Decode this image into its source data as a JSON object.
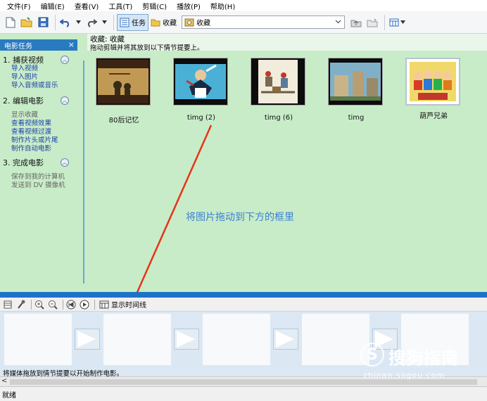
{
  "menu": [
    "文件(F)",
    "编辑(E)",
    "查看(V)",
    "工具(T)",
    "剪辑(C)",
    "播放(P)",
    "帮助(H)"
  ],
  "toolbar": {
    "tasks_label": "任务",
    "collections_label": "收藏",
    "combo_value": "收藏"
  },
  "taskpane": {
    "header": "电影任务",
    "close": "×",
    "sections": [
      {
        "title": "1. 捕获视频",
        "items": [
          "导入视频",
          "导入图片",
          "导入音频或音乐"
        ]
      },
      {
        "title": "2. 编辑电影",
        "items": [
          "显示收藏",
          "查看视频效果",
          "查看视频过渡",
          "制作片头或片尾",
          "制作自动电影"
        ]
      },
      {
        "title": "3. 完成电影",
        "items": [
          "保存到我的计算机",
          "发送到 DV 摄像机"
        ]
      }
    ]
  },
  "collection": {
    "title": "收藏: 收藏",
    "description": "拖动剪辑并将其放到以下情节提要上。",
    "clips": [
      {
        "name": "80后记忆"
      },
      {
        "name": "timg (2)"
      },
      {
        "name": "timg (6)"
      },
      {
        "name": "timg"
      },
      {
        "name": "葫芦兄弟"
      }
    ]
  },
  "annotation": "将图片拖动到下方的框里",
  "storyboard": {
    "timeline_toggle": "显示时间线",
    "hint": "将媒体拖放到情节提要以开始制作电影。"
  },
  "status": "就绪",
  "watermark": {
    "brand": "搜狗指南",
    "url": "zhinan.sogou.com",
    "logo": "S"
  },
  "colors": {
    "accent": "#1c73c8",
    "pane_bg": "#c8ecc8",
    "link": "#1a3fa8",
    "annotation": "#3b7fd6"
  }
}
